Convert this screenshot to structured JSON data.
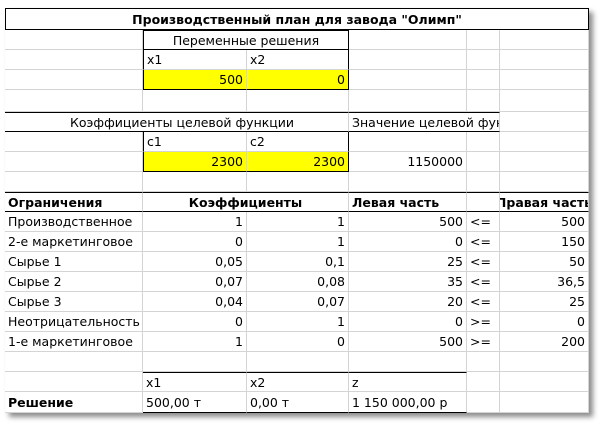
{
  "title": "Производственный план для завода \"Олимп\"",
  "variables": {
    "header": "Переменные решения",
    "x1_label": "x1",
    "x2_label": "x2",
    "x1_value": "500",
    "x2_value": "0"
  },
  "objective": {
    "coef_header": "Коэффициенты целевой функции",
    "value_header": "Значение целевой функции",
    "c1_label": "c1",
    "c2_label": "c2",
    "c1_value": "2300",
    "c2_value": "2300",
    "value": "1150000"
  },
  "constraints": {
    "headers": {
      "name": "Ограничения",
      "coefs": "Коэффициенты",
      "lhs": "Левая часть",
      "rhs": "Правая часть"
    },
    "rows": [
      {
        "name": "Производственное",
        "a1": "1",
        "a2": "1",
        "lhs": "500",
        "op": "<=",
        "rhs": "500"
      },
      {
        "name": "2-е маркетинговое",
        "a1": "0",
        "a2": "1",
        "lhs": "0",
        "op": "<=",
        "rhs": "150"
      },
      {
        "name": "Сырье 1",
        "a1": "0,05",
        "a2": "0,1",
        "lhs": "25",
        "op": "<=",
        "rhs": "50"
      },
      {
        "name": "Сырье 2",
        "a1": "0,07",
        "a2": "0,08",
        "lhs": "35",
        "op": "<=",
        "rhs": "36,5"
      },
      {
        "name": "Сырье 3",
        "a1": "0,04",
        "a2": "0,07",
        "lhs": "20",
        "op": "<=",
        "rhs": "25"
      },
      {
        "name": "Неотрицательность",
        "a1": "0",
        "a2": "1",
        "lhs": "0",
        "op": ">=",
        "rhs": "0"
      },
      {
        "name": "1-е маркетинговое",
        "a1": "1",
        "a2": "0",
        "lhs": "500",
        "op": ">=",
        "rhs": "200"
      }
    ]
  },
  "solution": {
    "label": "Решение",
    "x1_label": "x1",
    "x2_label": "x2",
    "z_label": "z",
    "x1_value": "500,00 т",
    "x2_value": "0,00 т",
    "z_value": "1 150 000,00 р"
  },
  "colors": {
    "input_fill": "#ffff00",
    "gridline": "#d4d4d4"
  }
}
